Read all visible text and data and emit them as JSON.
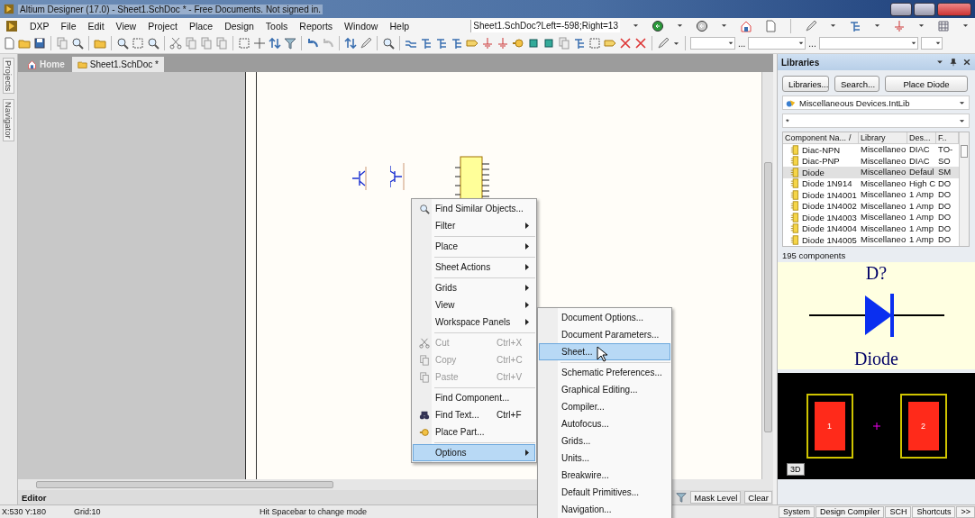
{
  "window": {
    "title": "Altium Designer (17.0) - Sheet1.SchDoc * - Free Documents. Not signed in."
  },
  "menu": [
    "DXP",
    "File",
    "Edit",
    "View",
    "Project",
    "Place",
    "Design",
    "Tools",
    "Reports",
    "Window",
    "Help"
  ],
  "address": {
    "value": "Sheet1.SchDoc?Left=-598;Right=13"
  },
  "combo_separators": [
    "...",
    "..."
  ],
  "side_tabs": [
    "Projects",
    "Navigator"
  ],
  "doc_tabs": [
    {
      "label": "Home",
      "selected": false
    },
    {
      "label": "Sheet1.SchDoc *",
      "selected": true
    }
  ],
  "context_menu": {
    "groups": [
      [
        {
          "label": "Find Similar Objects...",
          "kind": "search",
          "submenu": false,
          "disabled": false,
          "selected": false
        },
        {
          "label": "Filter",
          "kind": "none",
          "submenu": true,
          "disabled": false,
          "selected": false
        }
      ],
      [
        {
          "label": "Place",
          "kind": "none",
          "submenu": true,
          "disabled": false,
          "selected": false
        }
      ],
      [
        {
          "label": "Sheet Actions",
          "kind": "none",
          "submenu": true,
          "disabled": false,
          "selected": false
        }
      ],
      [
        {
          "label": "Grids",
          "kind": "none",
          "submenu": true,
          "disabled": false,
          "selected": false
        },
        {
          "label": "View",
          "kind": "none",
          "submenu": true,
          "disabled": false,
          "selected": false
        },
        {
          "label": "Workspace Panels",
          "kind": "none",
          "submenu": true,
          "disabled": false,
          "selected": false
        }
      ],
      [
        {
          "label": "Cut",
          "kind": "cut",
          "shortcut": "Ctrl+X",
          "submenu": false,
          "disabled": true,
          "selected": false
        },
        {
          "label": "Copy",
          "kind": "copy",
          "shortcut": "Ctrl+C",
          "submenu": false,
          "disabled": true,
          "selected": false
        },
        {
          "label": "Paste",
          "kind": "paste",
          "shortcut": "Ctrl+V",
          "submenu": false,
          "disabled": true,
          "selected": false
        }
      ],
      [
        {
          "label": "Find Component...",
          "kind": "none",
          "submenu": false,
          "disabled": false,
          "selected": false
        },
        {
          "label": "Find Text...",
          "kind": "binoculars",
          "shortcut": "Ctrl+F",
          "submenu": false,
          "disabled": false,
          "selected": false
        },
        {
          "label": "Place Part...",
          "kind": "plug",
          "submenu": false,
          "disabled": false,
          "selected": false
        }
      ],
      [
        {
          "label": "Options",
          "kind": "none",
          "submenu": true,
          "disabled": false,
          "selected": true
        }
      ]
    ]
  },
  "submenu": {
    "groups": [
      [
        {
          "label": "Document Options...",
          "selected": false
        },
        {
          "label": "Document Parameters...",
          "selected": false
        },
        {
          "label": "Sheet...",
          "selected": true
        }
      ],
      [
        {
          "label": "Schematic Preferences...",
          "selected": false
        },
        {
          "label": "Graphical Editing...",
          "selected": false
        },
        {
          "label": "Compiler...",
          "selected": false
        },
        {
          "label": "Autofocus...",
          "selected": false
        },
        {
          "label": "Grids...",
          "selected": false
        },
        {
          "label": "Units...",
          "selected": false
        },
        {
          "label": "Breakwire...",
          "selected": false
        },
        {
          "label": "Default Primitives...",
          "selected": false
        },
        {
          "label": "Navigation...",
          "selected": false
        }
      ]
    ]
  },
  "editor_bar": {
    "label": "Editor",
    "mask_level": "Mask Level",
    "clear": "Clear"
  },
  "libraries": {
    "title": "Libraries",
    "buttons": [
      "Libraries...",
      "Search...",
      "Place Diode"
    ],
    "library": "Miscellaneous Devices.IntLib",
    "filter": "*",
    "columns": [
      "Component Na...",
      "Library",
      "Des...",
      "F.."
    ],
    "sort_mark": "/",
    "rows": [
      {
        "name": "Diac-NPN",
        "library": "Miscellaneo",
        "description": "DIAC",
        "footprint": "TO-",
        "selected": false
      },
      {
        "name": "Diac-PNP",
        "library": "Miscellaneo",
        "description": "DIAC",
        "footprint": "SO",
        "selected": false
      },
      {
        "name": "Diode",
        "library": "Miscellaneo",
        "description": "Defaul",
        "footprint": "SM",
        "selected": true
      },
      {
        "name": "Diode 1N914",
        "library": "Miscellaneo",
        "description": "High C",
        "footprint": "DO",
        "selected": false
      },
      {
        "name": "Diode 1N4001",
        "library": "Miscellaneo",
        "description": "1 Amp",
        "footprint": "DO",
        "selected": false
      },
      {
        "name": "Diode 1N4002",
        "library": "Miscellaneo",
        "description": "1 Amp",
        "footprint": "DO",
        "selected": false
      },
      {
        "name": "Diode 1N4003",
        "library": "Miscellaneo",
        "description": "1 Amp",
        "footprint": "DO",
        "selected": false
      },
      {
        "name": "Diode 1N4004",
        "library": "Miscellaneo",
        "description": "1 Amp",
        "footprint": "DO",
        "selected": false
      },
      {
        "name": "Diode 1N4005",
        "library": "Miscellaneo",
        "description": "1 Amp",
        "footprint": "DO",
        "selected": false
      }
    ],
    "count": "195 components",
    "preview": {
      "designator": "D?",
      "comment": "Diode"
    },
    "footprint": {
      "pads": [
        "1",
        "2"
      ],
      "view_button": "3D"
    }
  },
  "status_bar": {
    "coords": "X:530 Y:180",
    "grid": "Grid:10",
    "hint": "Hit Spacebar to change mode",
    "buttons": [
      "System",
      "Design Compiler",
      "SCH",
      "Shortcuts",
      ">>"
    ]
  }
}
